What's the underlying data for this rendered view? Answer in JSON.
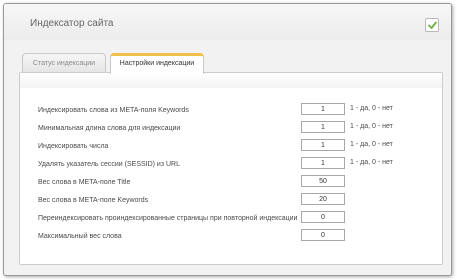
{
  "window": {
    "title": "Индексатор сайта"
  },
  "tabs": [
    {
      "label": "Статус индексации",
      "active": false
    },
    {
      "label": "Настройки индексации",
      "active": true
    }
  ],
  "colors": {
    "active_tab_accent": "#f0c24b",
    "check_icon": "#6cb33e"
  },
  "settings": {
    "rows": [
      {
        "label": "Индексировать слова из META-поля Keywords",
        "value": "1",
        "hint": "1 - да, 0 - нет"
      },
      {
        "label": "Минимальная длина слова для индексации",
        "value": "1",
        "hint": "1 - да, 0 - нет"
      },
      {
        "label": "Индексировать числа",
        "value": "1",
        "hint": "1 - да, 0 - нет"
      },
      {
        "label": "Удалять указатель сессии (SESSID) из URL",
        "value": "1",
        "hint": "1 - да, 0 - нет"
      },
      {
        "label": "Вес слова в META-поле Title",
        "value": "50",
        "hint": ""
      },
      {
        "label": "Вес слова в META-поле Keywords",
        "value": "20",
        "hint": ""
      },
      {
        "label": "Переиндексировать проиндексированные страницы при повторной индексации",
        "value": "0",
        "hint": ""
      },
      {
        "label": "Максимальный вес слова",
        "value": "0",
        "hint": ""
      }
    ]
  }
}
